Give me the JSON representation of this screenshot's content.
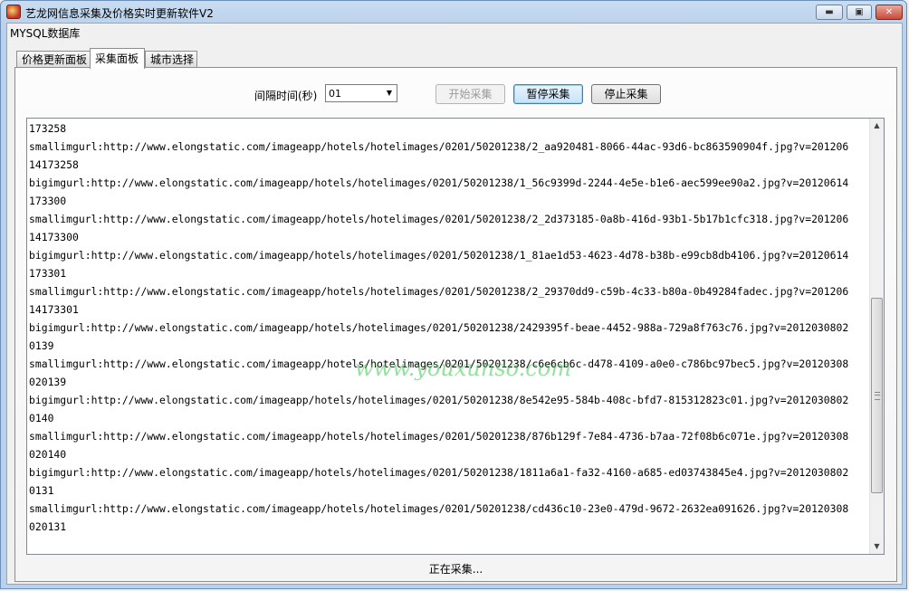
{
  "window": {
    "title": "艺龙网信息采集及价格实时更新软件V2",
    "minimize_glyph": "▬",
    "maximize_glyph": "▣",
    "close_glyph": "✕"
  },
  "menu": {
    "item": "MYSQL数据库"
  },
  "tabs": [
    {
      "label": "价格更新面板"
    },
    {
      "label": "采集面板"
    },
    {
      "label": "城市选择"
    }
  ],
  "controls": {
    "interval_label": "间隔时间(秒)",
    "interval_value": "01",
    "start_button": "开始采集",
    "pause_button": "暂停采集",
    "stop_button": "停止采集"
  },
  "log": {
    "lines": [
      "173258",
      "smallimgurl:http://www.elongstatic.com/imageapp/hotels/hotelimages/0201/50201238/2_aa920481-8066-44ac-93d6-bc863590904f.jpg?v=201206",
      "14173258",
      "bigimgurl:http://www.elongstatic.com/imageapp/hotels/hotelimages/0201/50201238/1_56c9399d-2244-4e5e-b1e6-aec599ee90a2.jpg?v=20120614",
      "173300",
      "smallimgurl:http://www.elongstatic.com/imageapp/hotels/hotelimages/0201/50201238/2_2d373185-0a8b-416d-93b1-5b17b1cfc318.jpg?v=201206",
      "14173300",
      "bigimgurl:http://www.elongstatic.com/imageapp/hotels/hotelimages/0201/50201238/1_81ae1d53-4623-4d78-b38b-e99cb8db4106.jpg?v=20120614",
      "173301",
      "smallimgurl:http://www.elongstatic.com/imageapp/hotels/hotelimages/0201/50201238/2_29370dd9-c59b-4c33-b80a-0b49284fadec.jpg?v=201206",
      "14173301",
      "bigimgurl:http://www.elongstatic.com/imageapp/hotels/hotelimages/0201/50201238/2429395f-beae-4452-988a-729a8f763c76.jpg?v=2012030802",
      "0139",
      "smallimgurl:http://www.elongstatic.com/imageapp/hotels/hotelimages/0201/50201238/c6e6cb6c-d478-4109-a0e0-c786bc97bec5.jpg?v=20120308",
      "020139",
      "bigimgurl:http://www.elongstatic.com/imageapp/hotels/hotelimages/0201/50201238/8e542e95-584b-408c-bfd7-815312823c01.jpg?v=2012030802",
      "0140",
      "smallimgurl:http://www.elongstatic.com/imageapp/hotels/hotelimages/0201/50201238/876b129f-7e84-4736-b7aa-72f08b6c071e.jpg?v=20120308",
      "020140",
      "bigimgurl:http://www.elongstatic.com/imageapp/hotels/hotelimages/0201/50201238/1811a6a1-fa32-4160-a685-ed03743845e4.jpg?v=2012030802",
      "0131",
      "smallimgurl:http://www.elongstatic.com/imageapp/hotels/hotelimages/0201/50201238/cd436c10-23e0-479d-9672-2632ea091626.jpg?v=20120308",
      "020131"
    ],
    "scroll_position": 0.78
  },
  "watermark": "www.youxunso.com",
  "status": "正在采集..."
}
